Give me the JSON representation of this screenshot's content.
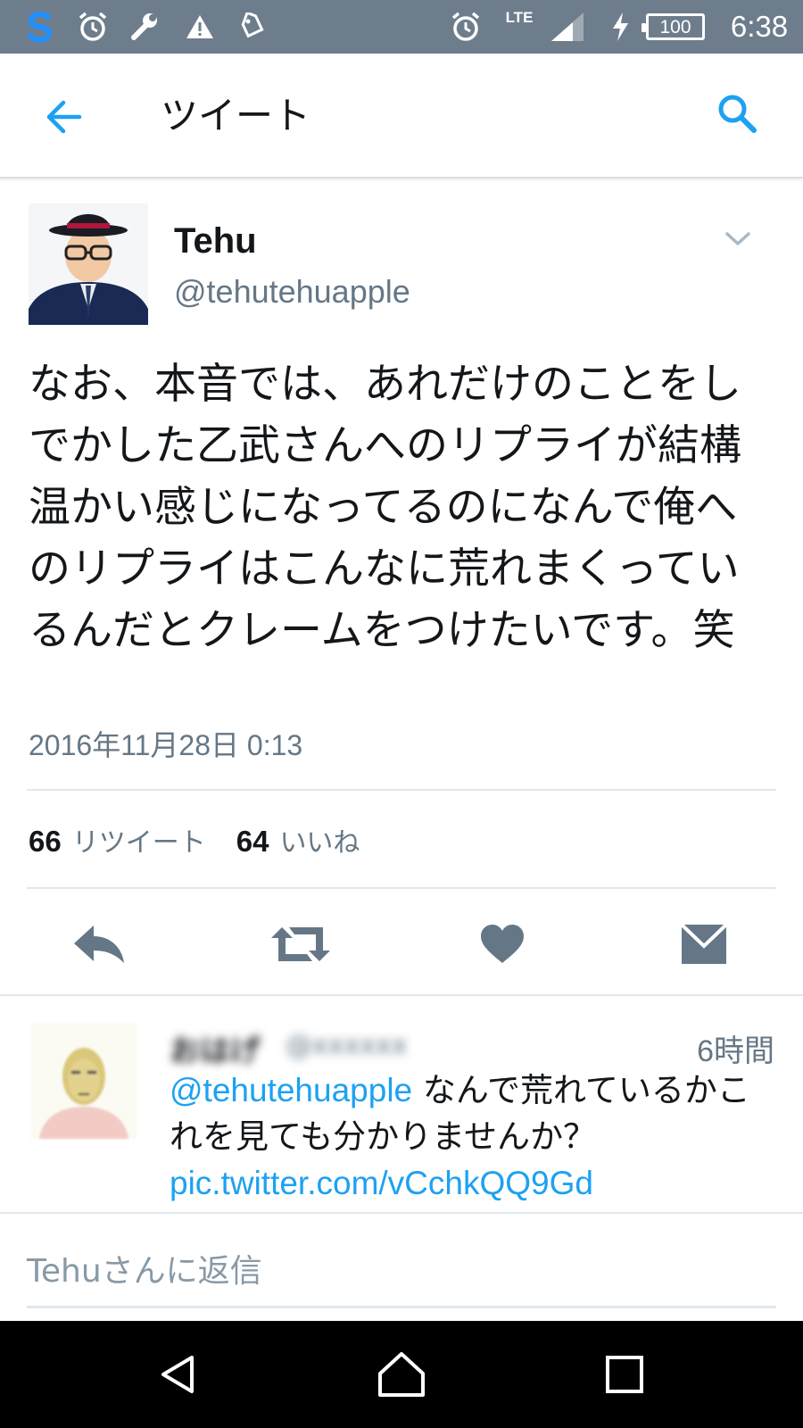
{
  "status_bar": {
    "icons": [
      "s-app-icon",
      "alarm-icon",
      "wrench-icon",
      "warning-icon",
      "tag-icon",
      "alarm-icon",
      "signal-icon",
      "charging-icon"
    ],
    "network": "LTE",
    "battery": "100",
    "time": "6:38"
  },
  "app_bar": {
    "title": "ツイート",
    "back_icon": "arrow-left-icon",
    "search_icon": "search-icon"
  },
  "tweet": {
    "display_name": "Tehu",
    "screen_name": "@tehutehuapple",
    "text": "なお、本音では、あれだけのことをしでかした乙武さんへのリプライが結構温かい感じになってるのになんで俺へのリプライはこんなに荒れまくっているんだとクレームをつけたいです。笑",
    "timestamp": "2016年11月28日 0:13",
    "retweet_count": "66",
    "retweet_label": "リツイート",
    "like_count": "64",
    "like_label": "いいね",
    "actions": [
      "reply-icon",
      "retweet-icon",
      "heart-icon",
      "message-icon"
    ]
  },
  "reply": {
    "display_name": "おはげ",
    "screen_name": "@xxxxxx",
    "time": "6時間",
    "mention": "@tehutehuapple",
    "text": " なんで荒れているかこれを見ても分かりませんか？",
    "link": "pic.twitter.com/vCchkQQ9Gd"
  },
  "reply_box": {
    "placeholder": "Tehuさんに返信"
  },
  "colors": {
    "accent": "#1da1f2",
    "status_bar": "#6e7d8c",
    "secondary_text": "#657786"
  }
}
